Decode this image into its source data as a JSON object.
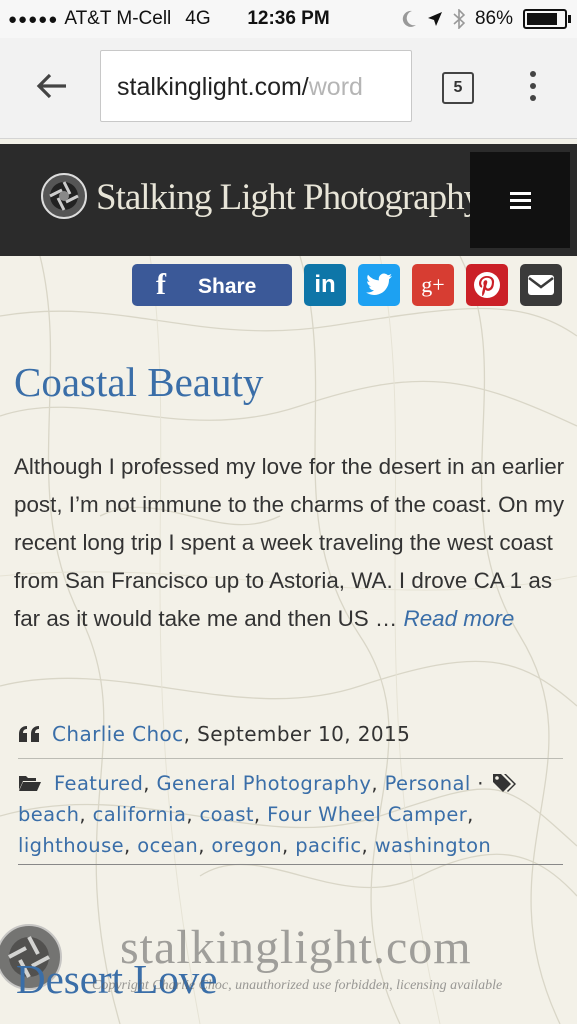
{
  "status_bar": {
    "carrier": "AT&T M-Cell",
    "network": "4G",
    "time": "12:36 PM",
    "battery": "86%"
  },
  "browser": {
    "url_main": "stalkinglight.com/",
    "url_faded": "word",
    "tab_count": "5"
  },
  "site": {
    "title": "Stalking Light Photography"
  },
  "share": {
    "facebook_label": "Share",
    "linkedin_glyph": "in",
    "googleplus_glyph": "g+"
  },
  "post": {
    "title": "Coastal Beauty",
    "excerpt": "Although I professed my love for the desert in an earlier post, I’m not immune to the charms of the coast. On my recent long trip I spent a week traveling the west coast from San Francisco up to Astoria, WA. I drove CA 1 as far as it would take me and then US … ",
    "read_more": "Read more",
    "author": "Charlie Choc",
    "date": ", September 10, 2015",
    "categories": [
      "Featured",
      "General Photography",
      "Personal"
    ],
    "tags": [
      "beach",
      "california",
      "coast",
      "Four Wheel Camper",
      "lighthouse",
      "ocean",
      "oregon",
      "pacific",
      "washington"
    ]
  },
  "next_post": {
    "title": "Desert Love"
  },
  "watermark": {
    "text": "stalkinglight.com",
    "sub": "Copyright Charlie Choc, unauthorized use forbidden, licensing available"
  },
  "colors": {
    "link": "#3a6ea8",
    "header_bg": "#2b2b2b",
    "facebook": "#3b5998",
    "linkedin": "#0e76a8",
    "twitter": "#1da1f2",
    "googleplus": "#d73d32",
    "pinterest": "#cb2027",
    "email": "#3a3a3a"
  }
}
